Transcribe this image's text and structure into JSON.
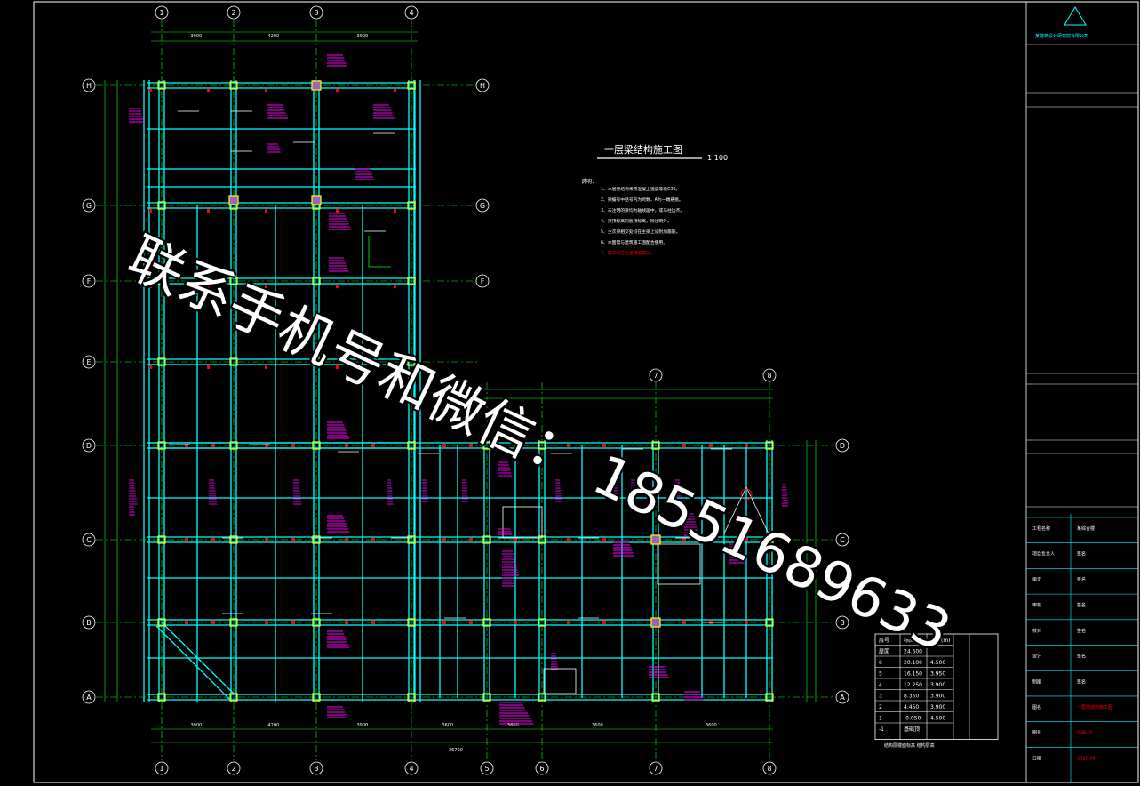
{
  "title_main": "一层梁结构施工图",
  "title_scale": "1:100",
  "notes_heading": "说明：",
  "notes": [
    "1、本层梁结构采用混凝土强度等级C30。",
    "2、梁编号中括号内为跨数，A为一端悬挑。",
    "3、未注明的梁均为轴线居中，或与柱边齐。",
    "4、梁顶标高同板顶标高，除注明外。",
    "5、主次梁相交处均在主梁上设附加箍筋。",
    "6、本图需与建筑施工图配合使用。",
    "7、施工时应注意预留洞口。"
  ],
  "watermark": "联系手机号和微信： 18551689633",
  "axes_top": [
    "1",
    "2",
    "3",
    "4"
  ],
  "axes_bottom": [
    "1",
    "2",
    "3",
    "4",
    "5",
    "6",
    "7",
    "8"
  ],
  "axes_left": [
    "H",
    "G",
    "F",
    "E",
    "D",
    "C",
    "B",
    "A"
  ],
  "axes_right": [
    "H",
    "G",
    "F",
    "D",
    "C",
    "B",
    "A"
  ],
  "axes_mid_top": [
    "7",
    "8"
  ],
  "dims_top": [
    "3900",
    "4200",
    "3900"
  ],
  "dims_bottom": [
    "3900",
    "4200",
    "3900",
    "3600",
    "3600",
    "3600",
    "3600"
  ],
  "dims_total_bottom": "26700",
  "floor_table": {
    "header": [
      "层号",
      "标高(m)",
      "层高(m)"
    ],
    "rows": [
      [
        "屋面",
        "24.600",
        ""
      ],
      [
        "6",
        "20.100",
        "4.500"
      ],
      [
        "5",
        "16.150",
        "3.950"
      ],
      [
        "4",
        "12.250",
        "3.900"
      ],
      [
        "3",
        "8.350",
        "3.900"
      ],
      [
        "2",
        "4.450",
        "3.900"
      ],
      [
        "1",
        "-0.050",
        "4.500"
      ],
      [
        "-1",
        "基础顶",
        ""
      ]
    ],
    "caption": "结构层楼面标高 结构层高"
  },
  "title_block": {
    "company": "某建筑设计研究院有限公司",
    "rows": [
      [
        "工程名称",
        "某综合楼"
      ],
      [
        "项目负责人",
        "签名"
      ],
      [
        "审定",
        "签名"
      ],
      [
        "审核",
        "签名"
      ],
      [
        "校对",
        "签名"
      ],
      [
        "设计",
        "签名"
      ],
      [
        "制图",
        "签名"
      ],
      [
        "图名",
        "一层梁结构施工图"
      ],
      [
        "图号",
        "结施-05"
      ],
      [
        "日期",
        "2016.08"
      ]
    ]
  },
  "colors": {
    "background": "#000000",
    "grid": "#00ff00",
    "beam": "#00ffff",
    "column": "#ffff00",
    "annotation": "#ff00ff",
    "marker": "#ff0000",
    "text": "#ffffff"
  }
}
